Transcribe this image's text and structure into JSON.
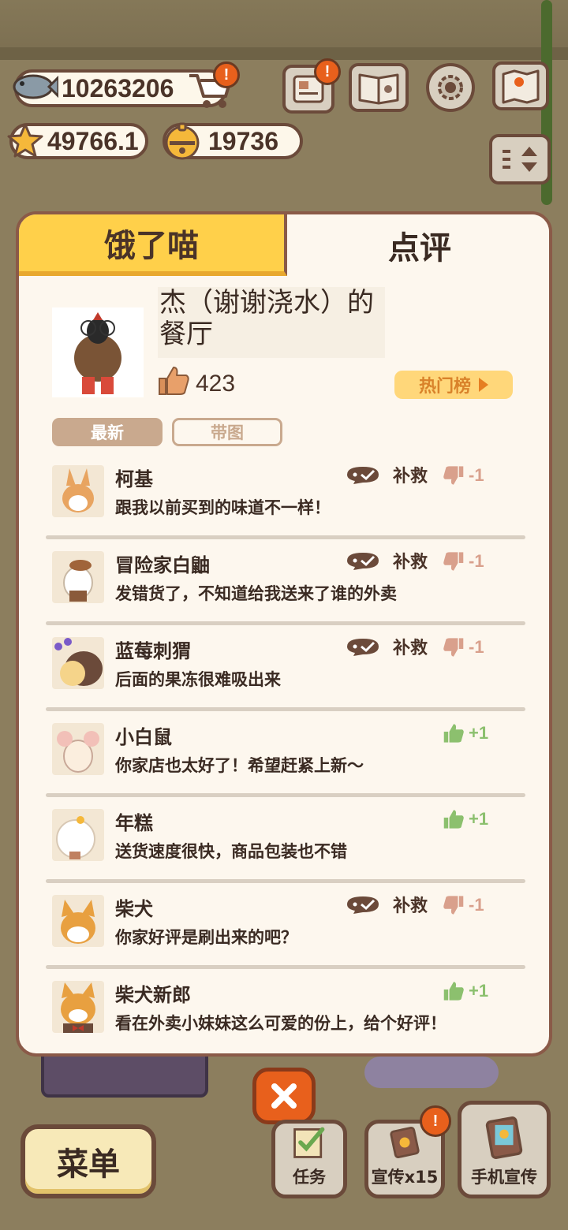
{
  "resources": {
    "fish": "10263206",
    "stars": "49766.1",
    "bells": "19736",
    "cart_alert": "!"
  },
  "top_buttons": {
    "news_alert": "!"
  },
  "tabs": {
    "hungry_meow": "饿了喵",
    "review": "点评"
  },
  "shop": {
    "name": "杰（谢谢浇水）的餐厅",
    "likes": "423",
    "hot_rank_label": "热门榜"
  },
  "filters": {
    "newest": "最新",
    "with_pic": "带图"
  },
  "reviews": [
    {
      "name": "柯基",
      "text": "跟我以前买到的味道不一样！",
      "rescue": "补救",
      "score": "-1",
      "sentiment": "negative"
    },
    {
      "name": "冒险家白鼬",
      "text": "发错货了，不知道给我送来了谁的外卖",
      "rescue": "补救",
      "score": "-1",
      "sentiment": "negative"
    },
    {
      "name": "蓝莓刺猬",
      "text": "后面的果冻很难吸出来",
      "rescue": "补救",
      "score": "-1",
      "sentiment": "negative"
    },
    {
      "name": "小白鼠",
      "text": "你家店也太好了！希望赶紧上新～",
      "rescue": "",
      "score": "+1",
      "sentiment": "positive"
    },
    {
      "name": "年糕",
      "text": "送货速度很快，商品包装也不错",
      "rescue": "",
      "score": "+1",
      "sentiment": "positive"
    },
    {
      "name": "柴犬",
      "text": "你家好评是刷出来的吧？",
      "rescue": "补救",
      "score": "-1",
      "sentiment": "negative"
    },
    {
      "name": "柴犬新郎",
      "text": "看在外卖小妹妹这么可爱的份上，给个好评！",
      "rescue": "",
      "score": "+1",
      "sentiment": "positive"
    }
  ],
  "bottom": {
    "menu": "菜单",
    "task": "任务",
    "promo": "宣传x15",
    "promo_alert": "!",
    "phone_promo": "手机宣传"
  },
  "colors": {
    "accent_yellow": "#ffd04a",
    "negative": "#d9a08c",
    "positive": "#8cc06e",
    "close_orange": "#e8601c"
  }
}
